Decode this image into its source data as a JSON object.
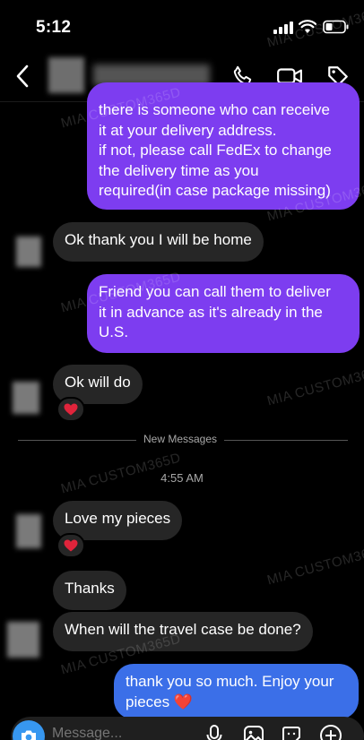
{
  "status_bar": {
    "time": "5:12"
  },
  "header": {
    "contact_name": ""
  },
  "messages": [
    {
      "side": "out",
      "text_lines": [
        "there is someone who can receive",
        "it at your delivery address.",
        "if not, please call FedEx to change",
        "the delivery time as you",
        "required(in case package missing)"
      ]
    },
    {
      "side": "in",
      "text": "Ok thank you I will be home"
    },
    {
      "side": "out",
      "text_lines": [
        "Friend you can call them to deliver",
        "it in advance as it's already in the",
        "U.S."
      ]
    },
    {
      "side": "in",
      "text": "Ok will do",
      "reaction": "❤️"
    },
    {
      "side": "in",
      "text": "Love my pieces",
      "reaction": "❤️"
    },
    {
      "side": "in",
      "text": "Thanks"
    },
    {
      "side": "in",
      "text": "When will the travel case be done?"
    },
    {
      "side": "out",
      "text_lines": [
        "thank you so much. Enjoy your",
        "pieces ❤️"
      ]
    }
  ],
  "divider": {
    "label": "New Messages"
  },
  "timestamp": "4:55 AM",
  "watermark": "MIA CUSTOM365D",
  "composer": {
    "placeholder": "Message..."
  },
  "colors": {
    "outgoing_bubble": "#7d3df0",
    "incoming_bubble": "#262626",
    "sent_latest_bubble": "#3b6fe8",
    "accent": "#3797f0"
  }
}
